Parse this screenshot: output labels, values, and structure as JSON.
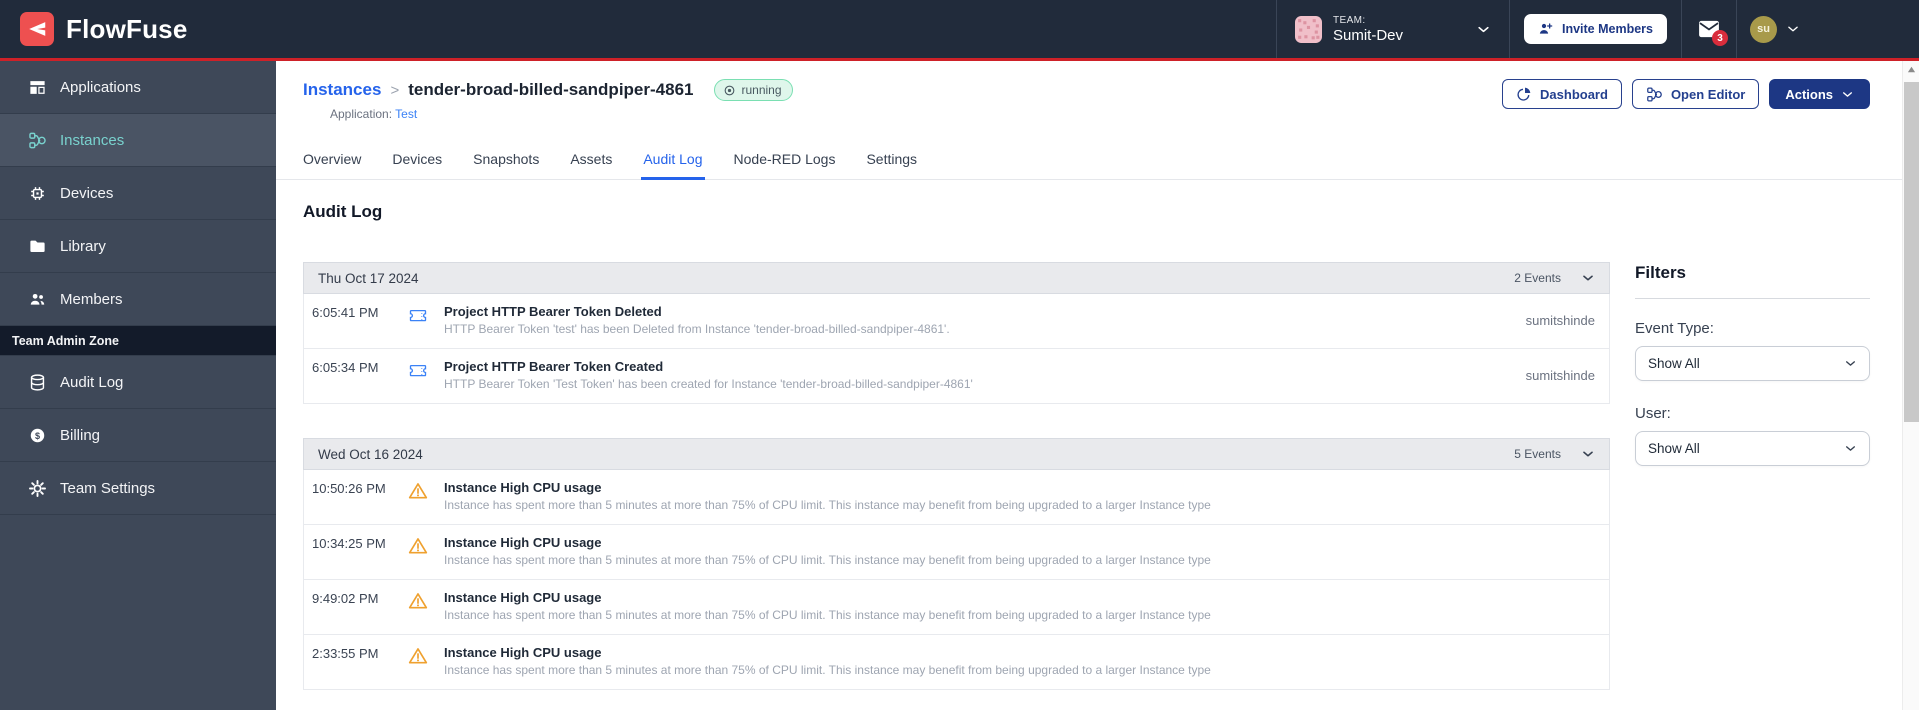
{
  "colors": {
    "brand_red": "#EE5050",
    "topbar_red_line": "#CE2128",
    "topbar_bg": "#212B3B",
    "sidebar_bg": "#3E4858",
    "sidebar_active_teal": "#79D2CE",
    "link_blue": "#2563EB",
    "button_navy": "#1D3784",
    "running_badge_bg": "#DFF6EB",
    "running_badge_border": "#7ADFB2",
    "warning_orange": "#EFA12F",
    "token_icon_blue": "#3B82F6",
    "notification_badge_red": "#D92D3C"
  },
  "topbar": {
    "brand": "FlowFuse",
    "team_label": "TEAM:",
    "team_name": "Sumit-Dev",
    "invite_button_label": "Invite Members",
    "notification_count": "3",
    "user_initials": "su"
  },
  "sidebar": {
    "items": [
      {
        "label": "Applications",
        "icon": "applications-icon"
      },
      {
        "label": "Instances",
        "icon": "instances-icon",
        "active": true
      },
      {
        "label": "Devices",
        "icon": "devices-icon"
      },
      {
        "label": "Library",
        "icon": "library-icon"
      },
      {
        "label": "Members",
        "icon": "members-icon"
      }
    ],
    "admin_zone_label": "Team Admin Zone",
    "admin_items": [
      {
        "label": "Audit Log",
        "icon": "audit-log-icon"
      },
      {
        "label": "Billing",
        "icon": "billing-icon"
      },
      {
        "label": "Team Settings",
        "icon": "team-settings-icon"
      }
    ]
  },
  "header": {
    "breadcrumb_root": "Instances",
    "breadcrumb_separator": ">",
    "instance_name": "tender-broad-billed-sandpiper-4861",
    "status": "running",
    "application_label": "Application:",
    "application_name": "Test",
    "dashboard_button": "Dashboard",
    "open_editor_button": "Open Editor",
    "actions_button": "Actions"
  },
  "tabs": [
    "Overview",
    "Devices",
    "Snapshots",
    "Assets",
    "Audit Log",
    "Node-RED Logs",
    "Settings"
  ],
  "audit": {
    "title": "Audit Log",
    "groups": [
      {
        "date": "Thu Oct 17 2024",
        "count": "2 Events",
        "events": [
          {
            "time": "6:05:41 PM",
            "icon": "token-icon",
            "title": "Project HTTP Bearer Token Deleted",
            "description": "HTTP Bearer Token 'test' has been Deleted from Instance 'tender-broad-billed-sandpiper-4861'.",
            "user": "sumitshinde"
          },
          {
            "time": "6:05:34 PM",
            "icon": "token-icon",
            "title": "Project HTTP Bearer Token Created",
            "description": "HTTP Bearer Token 'Test Token' has been created for Instance 'tender-broad-billed-sandpiper-4861'",
            "user": "sumitshinde"
          }
        ]
      },
      {
        "date": "Wed Oct 16 2024",
        "count": "5 Events",
        "events": [
          {
            "time": "10:50:26 PM",
            "icon": "warning-icon",
            "title": "Instance High CPU usage",
            "description": "Instance has spent more than 5 minutes at more than 75% of CPU limit. This instance may benefit from being upgraded to a larger Instance type",
            "user": ""
          },
          {
            "time": "10:34:25 PM",
            "icon": "warning-icon",
            "title": "Instance High CPU usage",
            "description": "Instance has spent more than 5 minutes at more than 75% of CPU limit. This instance may benefit from being upgraded to a larger Instance type",
            "user": ""
          },
          {
            "time": "9:49:02 PM",
            "icon": "warning-icon",
            "title": "Instance High CPU usage",
            "description": "Instance has spent more than 5 minutes at more than 75% of CPU limit. This instance may benefit from being upgraded to a larger Instance type",
            "user": ""
          },
          {
            "time": "2:33:55 PM",
            "icon": "warning-icon",
            "title": "Instance High CPU usage",
            "description": "Instance has spent more than 5 minutes at more than 75% of CPU limit. This instance may benefit from being upgraded to a larger Instance type",
            "user": ""
          }
        ]
      }
    ]
  },
  "filters": {
    "title": "Filters",
    "event_type_label": "Event Type:",
    "event_type_value": "Show All",
    "user_label": "User:",
    "user_value": "Show All"
  }
}
